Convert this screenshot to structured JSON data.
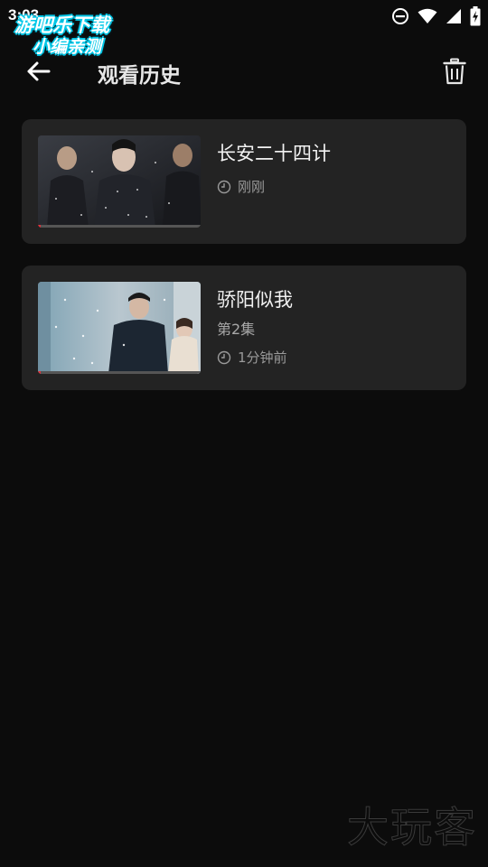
{
  "status_bar": {
    "time": "3:03",
    "icons": [
      "dnd-icon",
      "wifi-icon",
      "signal-icon",
      "battery-charging-icon"
    ]
  },
  "badge": {
    "line1": "游吧乐下载",
    "line2": "小编亲测"
  },
  "header": {
    "back_icon": "arrow-left-icon",
    "title": "观看历史",
    "delete_icon": "trash-icon"
  },
  "history": [
    {
      "title": "长安二十四计",
      "episode": "",
      "time": "刚刚",
      "progress": 0.01
    },
    {
      "title": "骄阳似我",
      "episode": "第2集",
      "time": "1分钟前",
      "progress": 0.01
    }
  ],
  "watermark": "大玩客",
  "colors": {
    "background": "#0c0c0c",
    "card": "#232323",
    "progress": "#e0313a",
    "badge_outline": "#00c8e8"
  }
}
